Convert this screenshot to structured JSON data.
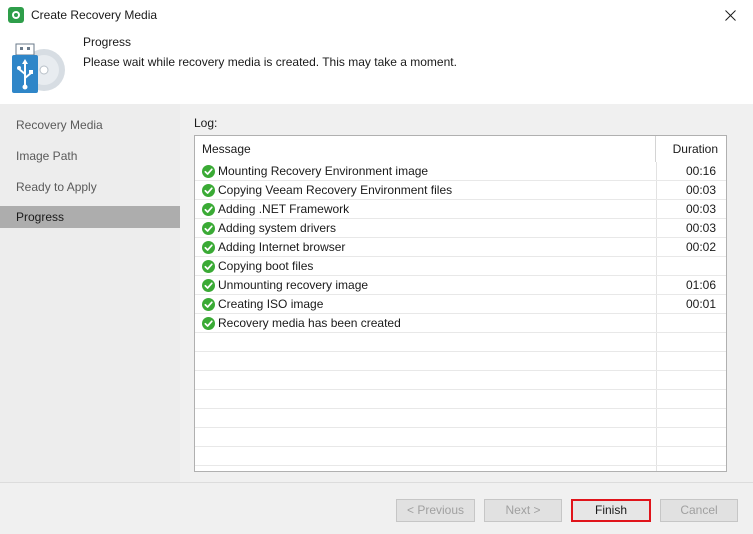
{
  "window": {
    "title": "Create Recovery Media",
    "icon": "veeam-icon",
    "close_glyph": "✕"
  },
  "header": {
    "title": "Progress",
    "description": "Please wait while recovery media is created. This may take a moment."
  },
  "sidebar": {
    "items": [
      {
        "label": "Recovery Media",
        "active": false
      },
      {
        "label": "Image Path",
        "active": false
      },
      {
        "label": "Ready to Apply",
        "active": false
      },
      {
        "label": "Progress",
        "active": true
      }
    ]
  },
  "log": {
    "label": "Log:",
    "columns": {
      "message": "Message",
      "duration": "Duration"
    },
    "rows": [
      {
        "message": "Mounting Recovery Environment image",
        "duration": "00:16",
        "status": "success"
      },
      {
        "message": "Copying Veeam Recovery Environment files",
        "duration": "00:03",
        "status": "success"
      },
      {
        "message": "Adding .NET Framework",
        "duration": "00:03",
        "status": "success"
      },
      {
        "message": "Adding system drivers",
        "duration": "00:03",
        "status": "success"
      },
      {
        "message": "Adding Internet browser",
        "duration": "00:02",
        "status": "success"
      },
      {
        "message": "Copying boot files",
        "duration": "",
        "status": "success"
      },
      {
        "message": "Unmounting recovery image",
        "duration": "01:06",
        "status": "success"
      },
      {
        "message": "Creating ISO image",
        "duration": "00:01",
        "status": "success"
      },
      {
        "message": "Recovery media has been created",
        "duration": "",
        "status": "success"
      }
    ]
  },
  "buttons": {
    "previous": "< Previous",
    "next": "Next >",
    "finish": "Finish",
    "cancel": "Cancel"
  },
  "colors": {
    "success": "#3aaa35",
    "highlight": "#e0141b",
    "active_nav": "#adadad"
  }
}
